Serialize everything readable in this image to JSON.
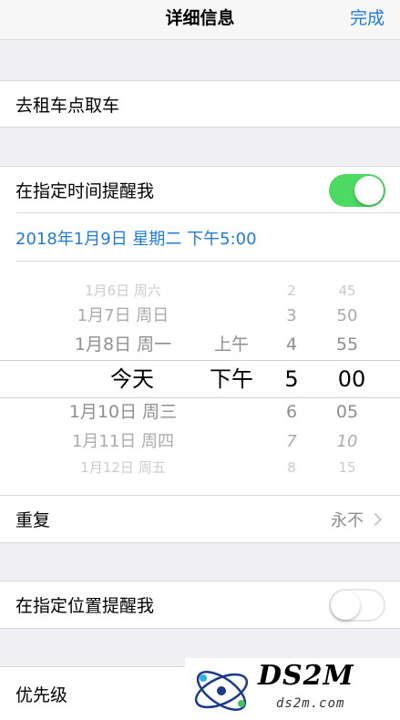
{
  "navbar": {
    "title": "详细信息",
    "done_label": "完成"
  },
  "task": {
    "title": "去租车点取车"
  },
  "time_reminder": {
    "label": "在指定时间提醒我",
    "enabled": true,
    "datetime": "2018年1月9日 星期二 下午5:00"
  },
  "picker": {
    "date_column": [
      "1月6日 周六",
      "1月7日 周日",
      "1月8日 周一",
      "今天",
      "1月10日 周三",
      "1月11日 周四",
      "1月12日 周五"
    ],
    "ampm_column": [
      "上午",
      "下午"
    ],
    "hour_column": [
      "2",
      "3",
      "4",
      "5",
      "6",
      "7",
      "8"
    ],
    "minute_column": [
      "45",
      "50",
      "55",
      "00",
      "05",
      "10",
      "15"
    ],
    "selected": {
      "date": "今天",
      "ampm": "下午",
      "hour": "5",
      "minute": "00"
    }
  },
  "repeat": {
    "label": "重复",
    "value": "永不"
  },
  "location_reminder": {
    "label": "在指定位置提醒我",
    "enabled": false
  },
  "priority": {
    "label": "优先级"
  },
  "watermark": {
    "brand": "DS2M",
    "url": "ds2m.com"
  },
  "colors": {
    "accent": "#1f7cd9",
    "toggle_on": "#4cd964",
    "background": "#efeff4"
  }
}
